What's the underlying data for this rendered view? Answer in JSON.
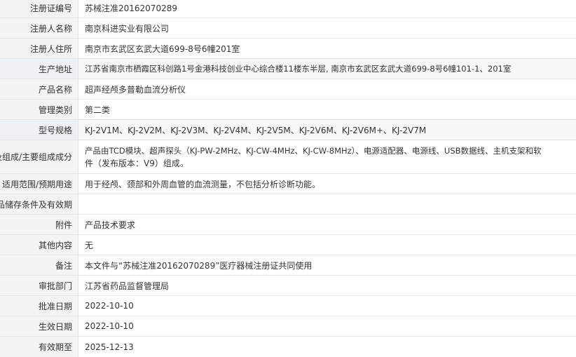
{
  "rows": [
    {
      "label": "注册证编号",
      "value": "苏械注准20162070289"
    },
    {
      "label": "注册人名称",
      "value": "南京科进实业有限公司"
    },
    {
      "label": "注册人住所",
      "value": "南京市玄武区玄武大道699-8号6幢201室"
    },
    {
      "label": "生产地址",
      "value": "江苏省南京市栖霞区科创路1号金港科技创业中心综合楼11楼东半层, 南京市玄武区玄武大道699-8号6幢101-1、201室"
    },
    {
      "label": "产品名称",
      "value": "超声经颅多普勒血流分析仪"
    },
    {
      "label": "管理类别",
      "value": "第二类"
    },
    {
      "label": "型号规格",
      "value": "KJ-2V1M、KJ-2V2M、KJ-2V3M、KJ-2V4M、KJ-2V5M、KJ-2V6M、KJ-2V6M+、KJ-2V7M"
    },
    {
      "label": "结构及组成/主要组成成分",
      "value_line1": "产品由TCD模块、超声探头（KJ-PW-2MHz、KJ-CW-4MHz、KJ-CW-8MHz）、电源适配器、电源线、USB数据线、主机支架和软",
      "value_line2": "件（发布版本：V9）组成。"
    },
    {
      "label": "适用范围/预期用途",
      "value": "用于经颅、颈部和外周血管的血流测量，不包括分析诊断功能。"
    },
    {
      "label": "产品储存条件及有效期",
      "value": ""
    },
    {
      "label": "附件",
      "value": "产品技术要求"
    },
    {
      "label": "其他内容",
      "value": "无"
    },
    {
      "label": "备注",
      "value": "本文件与“苏械注准20162070289”医疗器械注册证共同使用"
    },
    {
      "label": "审批部门",
      "value": "江苏省药品监督管理局"
    },
    {
      "label": "批准日期",
      "value": "2022-10-10"
    },
    {
      "label": "生效日期",
      "value": "2022-10-10"
    },
    {
      "label": "有效期至",
      "value": "2025-12-13"
    }
  ]
}
